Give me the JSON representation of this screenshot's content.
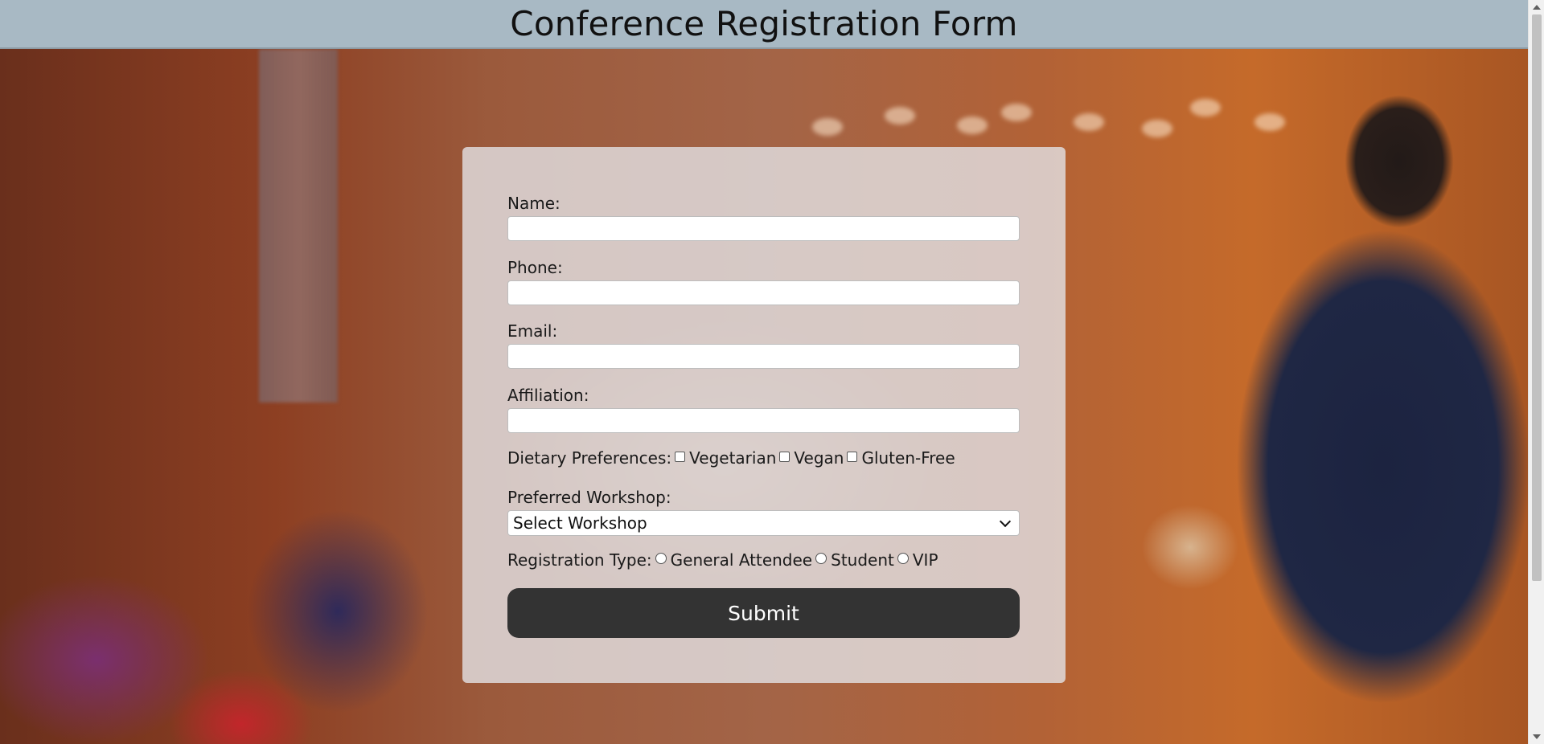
{
  "header": {
    "title": "Conference Registration Form"
  },
  "form": {
    "name_label": "Name:",
    "name_value": "",
    "phone_label": "Phone:",
    "phone_value": "",
    "email_label": "Email:",
    "email_value": "",
    "affiliation_label": "Affiliation:",
    "affiliation_value": "",
    "dietary": {
      "label": "Dietary Preferences:",
      "options": [
        "Vegetarian",
        "Vegan",
        "Gluten-Free"
      ]
    },
    "workshop": {
      "label": "Preferred Workshop:",
      "selected": "Select Workshop"
    },
    "registration_type": {
      "label": "Registration Type:",
      "options": [
        "General Attendee",
        "Student",
        "VIP"
      ]
    },
    "submit_label": "Submit"
  },
  "colors": {
    "header_bg": "#a8b9c4",
    "panel_bg": "rgba(226,223,226,0.82)",
    "submit_bg": "#333333"
  }
}
